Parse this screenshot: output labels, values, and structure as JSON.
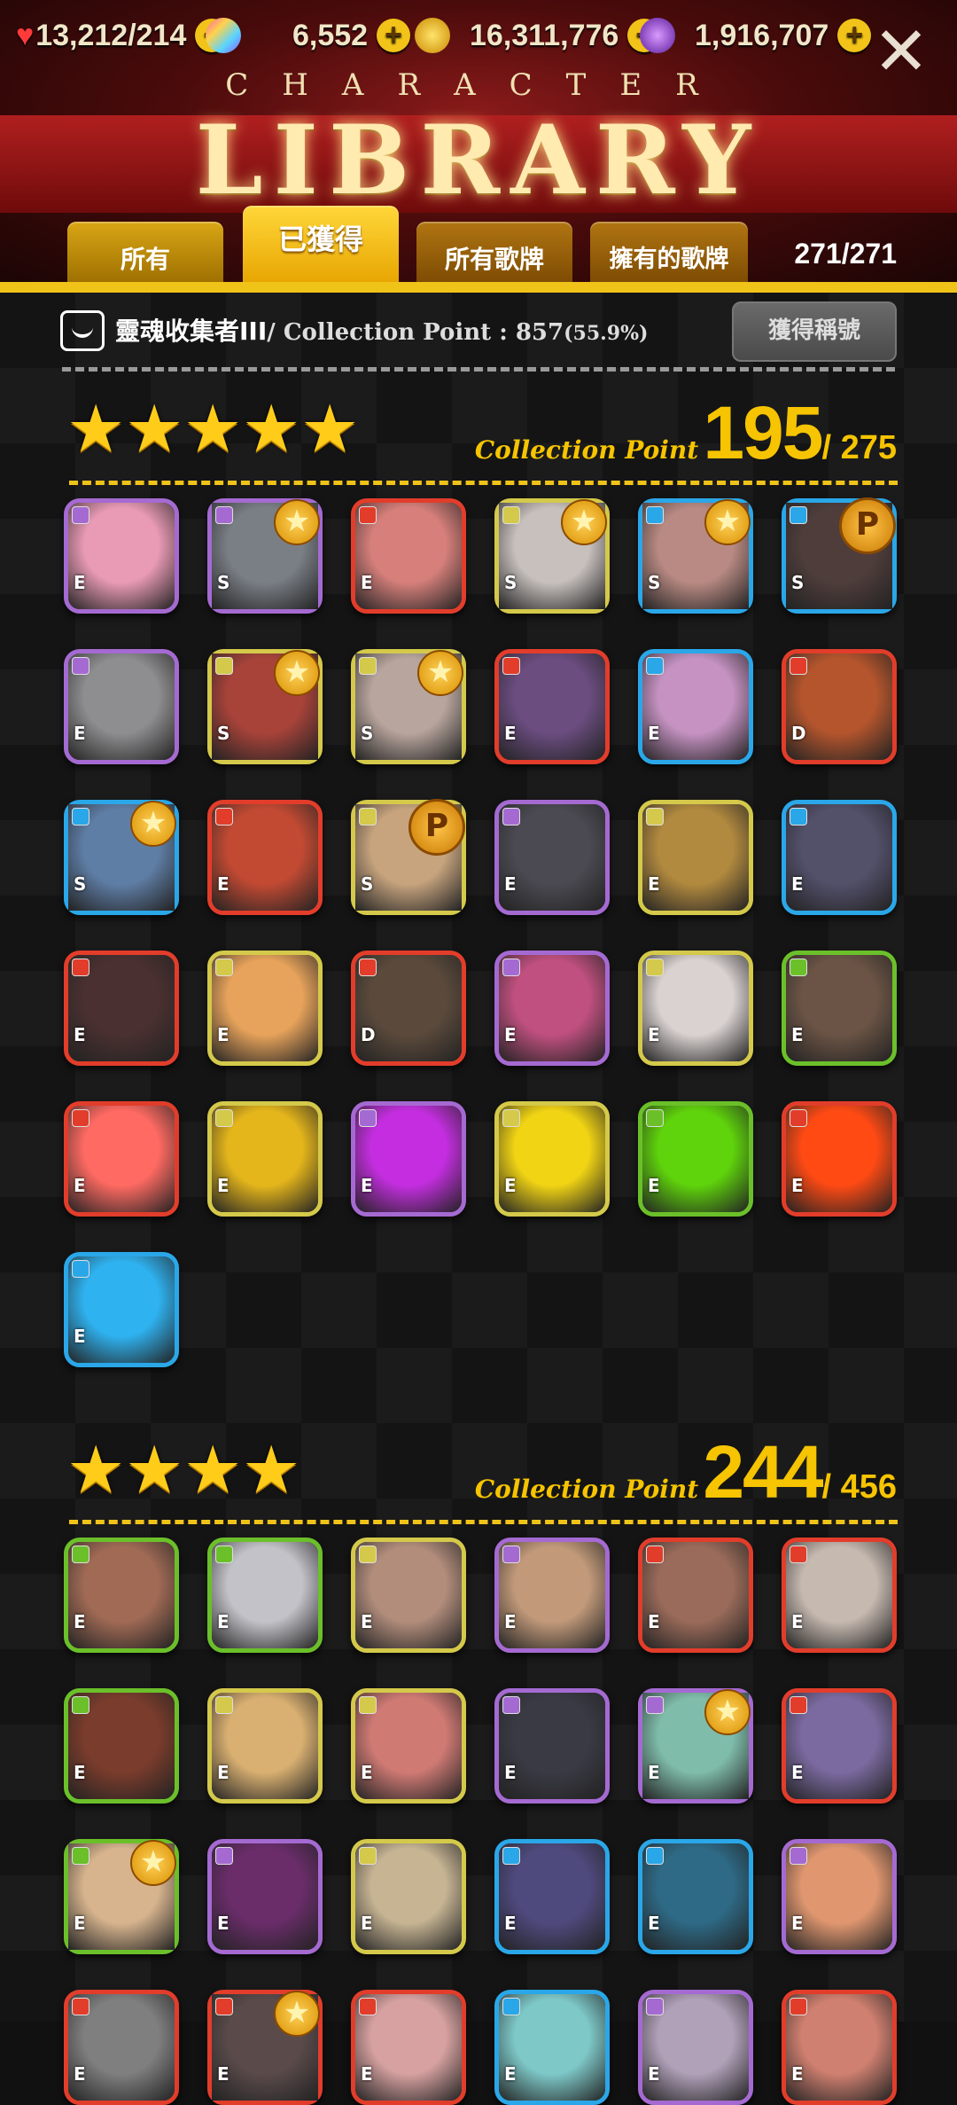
{
  "resources": {
    "hearts": {
      "value": "13,212",
      "max": "/214"
    },
    "gems": {
      "value": "6,552"
    },
    "gold": {
      "value": "16,311,776"
    },
    "crystal": {
      "value": "1,916,707"
    }
  },
  "header": {
    "subtitle": "CHARACTER",
    "title": "LIBRARY"
  },
  "tabs": [
    {
      "label": "所有"
    },
    {
      "label": "已獲得"
    },
    {
      "label": "所有歌牌"
    },
    {
      "label": "擁有的歌牌"
    }
  ],
  "count": "271/271",
  "collector": {
    "name": "靈魂收集者III",
    "cp_label": "/ Collection Point : 857",
    "percent": "(55.9%)",
    "button": "獲得稱號"
  },
  "sections": [
    {
      "stars": 5,
      "cp_label": "Collection Point",
      "cp_value": "195",
      "cp_total": "/ 275"
    },
    {
      "stars": 4,
      "cp_label": "Collection Point",
      "cp_value": "244",
      "cp_total": "/ 456"
    }
  ],
  "colors": {
    "accent": "#f0c319",
    "frame_dark": "#a56ad2",
    "frame_fire": "#e23d2b",
    "frame_water": "#2aa7e8",
    "frame_light": "#d4c94a",
    "frame_nature": "#6bc02a"
  },
  "section1_cards": [
    {
      "frame": "#a56ad2",
      "rank": "E",
      "art": "#e99ab5",
      "badge": ""
    },
    {
      "frame": "#a56ad2",
      "rank": "S",
      "art": "#7a7f86",
      "badge": "star"
    },
    {
      "frame": "#e23d2b",
      "rank": "E",
      "art": "#d7807b",
      "badge": ""
    },
    {
      "frame": "#d4c94a",
      "rank": "S",
      "art": "#c7c0bd",
      "badge": "star"
    },
    {
      "frame": "#2aa7e8",
      "rank": "S",
      "art": "#b98a83",
      "badge": "star"
    },
    {
      "frame": "#2aa7e8",
      "rank": "S",
      "art": "#4e3d3b",
      "badge": "p"
    },
    {
      "frame": "#a56ad2",
      "rank": "E",
      "art": "#8e8e90",
      "badge": ""
    },
    {
      "frame": "#d4c94a",
      "rank": "S",
      "art": "#a8433a",
      "badge": "star"
    },
    {
      "frame": "#d4c94a",
      "rank": "S",
      "art": "#b8a59d",
      "badge": "star"
    },
    {
      "frame": "#e23d2b",
      "rank": "E",
      "art": "#6b4d80",
      "badge": ""
    },
    {
      "frame": "#2aa7e8",
      "rank": "E",
      "art": "#c592c2",
      "badge": ""
    },
    {
      "frame": "#e23d2b",
      "rank": "D",
      "art": "#b4552d",
      "badge": ""
    },
    {
      "frame": "#2aa7e8",
      "rank": "S",
      "art": "#5f7ea6",
      "badge": "star"
    },
    {
      "frame": "#e23d2b",
      "rank": "E",
      "art": "#c24a33",
      "badge": ""
    },
    {
      "frame": "#d4c94a",
      "rank": "S",
      "art": "#c7a47e",
      "badge": "p"
    },
    {
      "frame": "#a56ad2",
      "rank": "E",
      "art": "#4b4a52",
      "badge": ""
    },
    {
      "frame": "#d4c94a",
      "rank": "E",
      "art": "#b28a3f",
      "badge": ""
    },
    {
      "frame": "#2aa7e8",
      "rank": "E",
      "art": "#53506a",
      "badge": ""
    },
    {
      "frame": "#e23d2b",
      "rank": "E",
      "art": "#4a3030",
      "badge": ""
    },
    {
      "frame": "#d4c94a",
      "rank": "E",
      "art": "#e7a35b",
      "badge": ""
    },
    {
      "frame": "#e23d2b",
      "rank": "D",
      "art": "#5b4a3c",
      "badge": ""
    },
    {
      "frame": "#a56ad2",
      "rank": "E",
      "art": "#c0507f",
      "badge": ""
    },
    {
      "frame": "#d4c94a",
      "rank": "E",
      "art": "#d9d2d0",
      "badge": ""
    },
    {
      "frame": "#6bc02a",
      "rank": "E",
      "art": "#6b5445",
      "badge": ""
    },
    {
      "frame": "#e23d2b",
      "rank": "E",
      "art": "#ff6a62",
      "badge": ""
    },
    {
      "frame": "#d4c94a",
      "rank": "E",
      "art": "#e5b61b",
      "badge": ""
    },
    {
      "frame": "#a56ad2",
      "rank": "E",
      "art": "#c42ee0",
      "badge": ""
    },
    {
      "frame": "#d4c94a",
      "rank": "E",
      "art": "#f1d414",
      "badge": ""
    },
    {
      "frame": "#6bc02a",
      "rank": "E",
      "art": "#5fd30b",
      "badge": ""
    },
    {
      "frame": "#e23d2b",
      "rank": "E",
      "art": "#ff4a14",
      "badge": ""
    },
    {
      "frame": "#2aa7e8",
      "rank": "E",
      "art": "#2fb2f0",
      "badge": ""
    }
  ],
  "section2_cards": [
    {
      "frame": "#6bc02a",
      "rank": "E",
      "art": "#a06a55",
      "badge": ""
    },
    {
      "frame": "#6bc02a",
      "rank": "E",
      "art": "#c2c2c8",
      "badge": ""
    },
    {
      "frame": "#d4c94a",
      "rank": "E",
      "art": "#b28d7c",
      "badge": ""
    },
    {
      "frame": "#a56ad2",
      "rank": "E",
      "art": "#c29a7a",
      "badge": ""
    },
    {
      "frame": "#e23d2b",
      "rank": "E",
      "art": "#9a6b5a",
      "badge": ""
    },
    {
      "frame": "#e23d2b",
      "rank": "E",
      "art": "#c6b9b0",
      "badge": ""
    },
    {
      "frame": "#6bc02a",
      "rank": "E",
      "art": "#7a3c2c",
      "badge": ""
    },
    {
      "frame": "#d4c94a",
      "rank": "E",
      "art": "#d9b071",
      "badge": ""
    },
    {
      "frame": "#d4c94a",
      "rank": "E",
      "art": "#d07a74",
      "badge": ""
    },
    {
      "frame": "#a56ad2",
      "rank": "E",
      "art": "#3a3a44",
      "badge": ""
    },
    {
      "frame": "#a56ad2",
      "rank": "E",
      "art": "#7fbcaa",
      "badge": "star"
    },
    {
      "frame": "#e23d2b",
      "rank": "E",
      "art": "#7b6aa0",
      "badge": ""
    },
    {
      "frame": "#6bc02a",
      "rank": "E",
      "art": "#d7b48e",
      "badge": "star"
    },
    {
      "frame": "#a56ad2",
      "rank": "E",
      "art": "#6a2d6a",
      "badge": ""
    },
    {
      "frame": "#d4c94a",
      "rank": "E",
      "art": "#c6b493",
      "badge": ""
    },
    {
      "frame": "#2aa7e8",
      "rank": "E",
      "art": "#4f4a7e",
      "badge": ""
    },
    {
      "frame": "#2aa7e8",
      "rank": "E",
      "art": "#2e6a86",
      "badge": ""
    },
    {
      "frame": "#a56ad2",
      "rank": "E",
      "art": "#e09770",
      "badge": ""
    },
    {
      "frame": "#e23d2b",
      "rank": "E",
      "art": "#7f7f80",
      "badge": ""
    },
    {
      "frame": "#e23d2b",
      "rank": "E",
      "art": "#5a4a4a",
      "badge": "star"
    },
    {
      "frame": "#e23d2b",
      "rank": "E",
      "art": "#d6a1a0",
      "badge": ""
    },
    {
      "frame": "#2aa7e8",
      "rank": "E",
      "art": "#7ec8c8",
      "badge": ""
    },
    {
      "frame": "#a56ad2",
      "rank": "E",
      "art": "#b0a0b8",
      "badge": ""
    },
    {
      "frame": "#e23d2b",
      "rank": "E",
      "art": "#d08070",
      "badge": ""
    }
  ]
}
